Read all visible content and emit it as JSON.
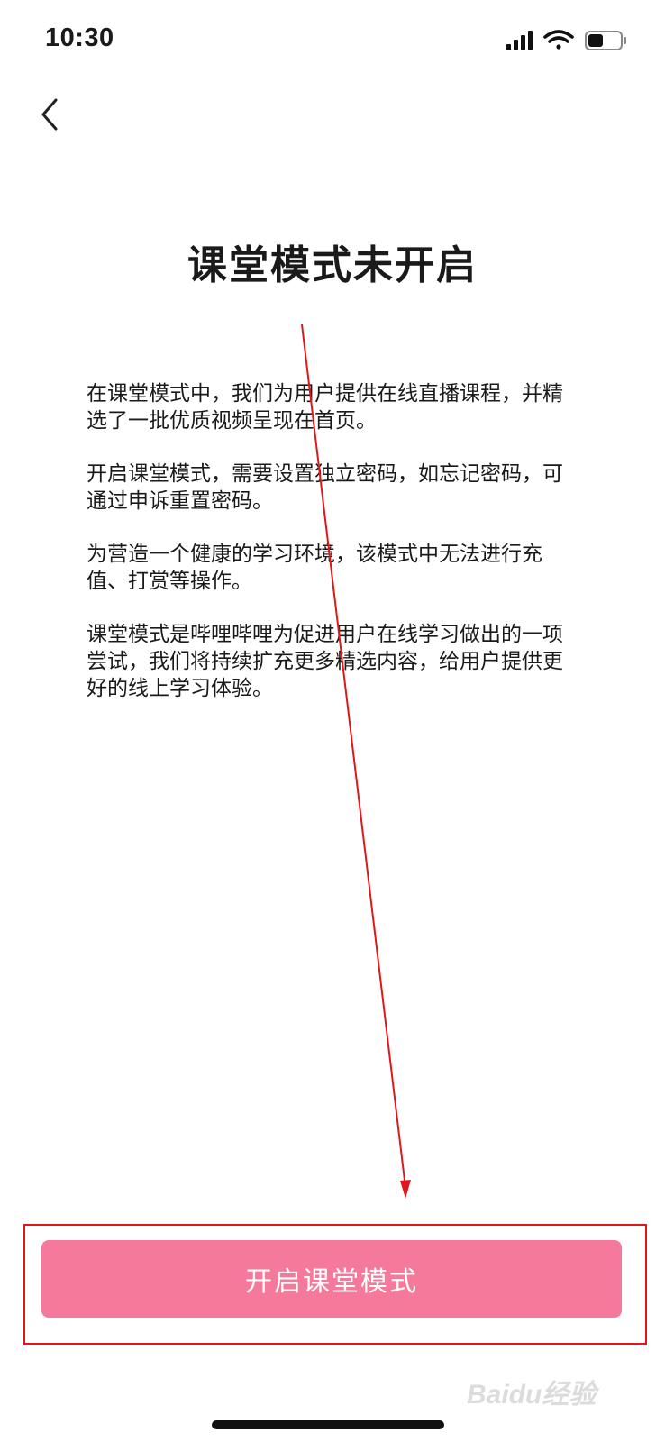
{
  "status_bar": {
    "time": "10:30",
    "icons": [
      "signal-icon",
      "wifi-icon",
      "battery-icon"
    ]
  },
  "nav": {
    "back_icon": "chevron-left-icon"
  },
  "page": {
    "title": "课堂模式未开启",
    "paragraphs": [
      "在课堂模式中，我们为用户提供在线直播课程，并精选了一批优质视频呈现在首页。",
      "开启课堂模式，需要设置独立密码，如忘记密码，可通过申诉重置密码。",
      "为营造一个健康的学习环境，该模式中无法进行充值、打赏等操作。",
      "课堂模式是哔哩哔哩为促进用户在线学习做出的一项尝试，我们将持续扩充更多精选内容，给用户提供更好的线上学习体验。"
    ]
  },
  "action": {
    "button_label": "开启课堂模式",
    "button_color": "#f5799b"
  },
  "annotation": {
    "color": "#e0161a"
  },
  "watermark": {
    "text": "Baidu经验"
  }
}
